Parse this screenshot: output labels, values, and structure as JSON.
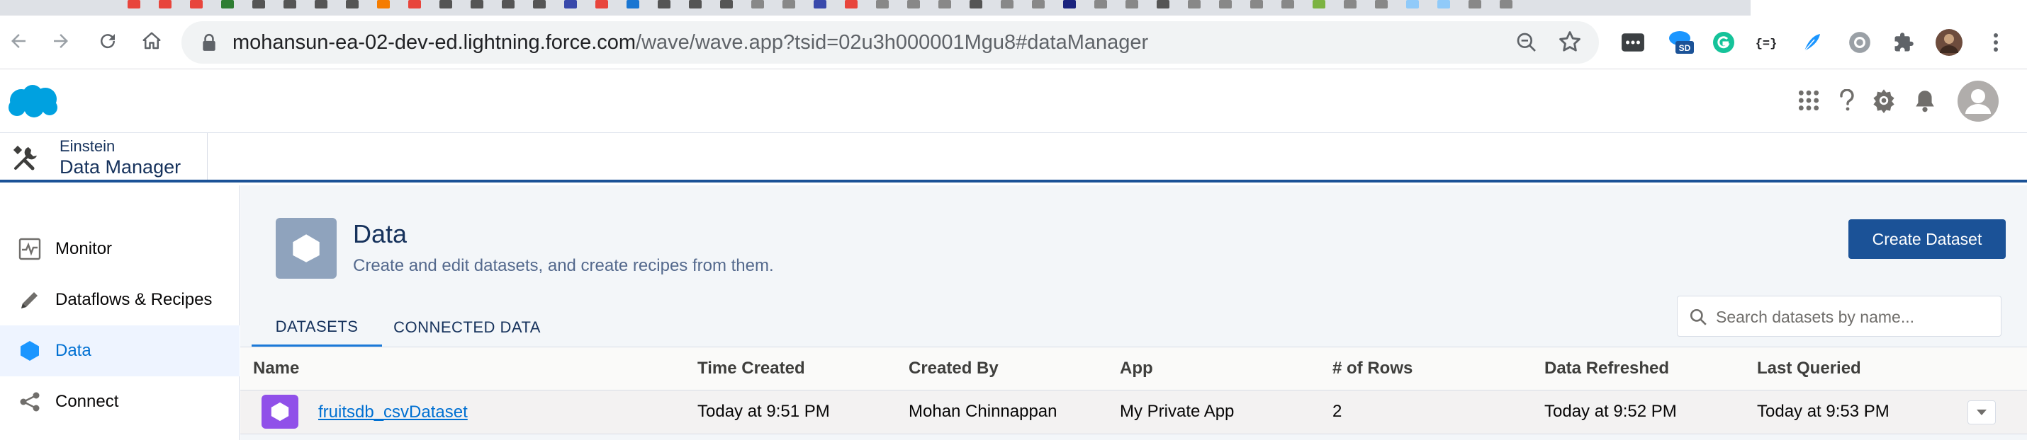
{
  "browser": {
    "url_host": "mohansun-ea-02-dev-ed.lightning.force.com",
    "url_path": "/wave/wave.app?tsid=02u3h000001Mgu8#dataManager",
    "extension_badge": "SD"
  },
  "app": {
    "name_line1": "Einstein",
    "name_line2": "Data Manager"
  },
  "nav": {
    "items": [
      {
        "label": "Monitor",
        "icon": "monitor-icon"
      },
      {
        "label": "Dataflows & Recipes",
        "icon": "pencil-icon"
      },
      {
        "label": "Data",
        "icon": "data-hexagon-icon",
        "active": true
      },
      {
        "label": "Connect",
        "icon": "connect-icon"
      }
    ]
  },
  "page": {
    "title": "Data",
    "subtitle": "Create and edit datasets, and create recipes from them.",
    "create_button": "Create Dataset",
    "tabs": [
      {
        "label": "DATASETS",
        "active": true
      },
      {
        "label": "CONNECTED DATA",
        "active": false
      }
    ],
    "search_placeholder": "Search datasets by name..."
  },
  "table": {
    "headers": [
      "Name",
      "Time Created",
      "Created By",
      "App",
      "# of Rows",
      "Data Refreshed",
      "Last Queried"
    ],
    "rows": [
      {
        "name": "fruitsdb_csvDataset",
        "time_created": "Today at 9:51 PM",
        "created_by": "Mohan Chinnappan",
        "app": "My Private App",
        "rows": "2",
        "data_refreshed": "Today at 9:52 PM",
        "last_queried": "Today at 9:53 PM"
      }
    ]
  },
  "colors": {
    "brand_blue": "#1b5297",
    "link_blue": "#0070d2",
    "dataset_purple": "#9050e9",
    "salesforce_cloud": "#00a1e0"
  }
}
